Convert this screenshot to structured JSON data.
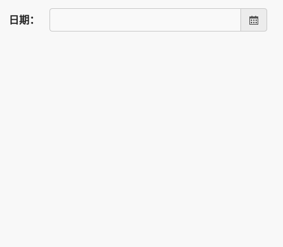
{
  "form": {
    "date_label": "日期：",
    "date_input": {
      "value": "",
      "placeholder": ""
    },
    "calendar_button": {
      "icon": "calendar-icon"
    }
  },
  "colors": {
    "background": "#f8f8f8",
    "border": "#cccccc",
    "button_background": "#ececec",
    "icon": "#555555"
  }
}
